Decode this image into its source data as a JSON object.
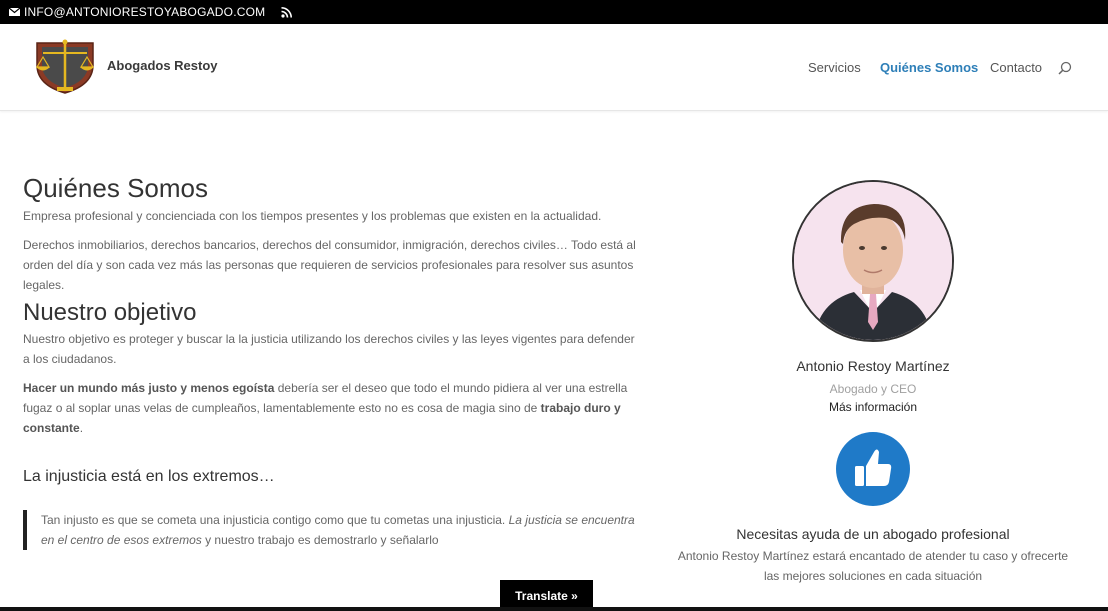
{
  "topbar": {
    "email": "INFO@ANTONIORESTOYABOGADO.COM",
    "mail_icon": "mail-icon",
    "rss_icon": "rss-icon"
  },
  "header": {
    "brand": "Abogados Restoy",
    "nav": [
      "Servicios",
      "Quiénes Somos",
      "Contacto"
    ],
    "active_nav": "Quiénes Somos",
    "accent_color": "#2e7fb8"
  },
  "main": {
    "title": "Quiénes Somos",
    "intro": "Empresa profesional y concienciada con los tiempos presentes y los problemas que existen en la actualidad.",
    "para1": "Derechos inmobiliarios, derechos bancarios, derechos del consumidor, inmigración, derechos civiles… Todo está al orden del día y son cada vez más las personas que requieren de servicios profesionales para resolver sus asuntos legales.",
    "title2": "Nuestro objetivo",
    "para2": "Nuestro objetivo es proteger y buscar la la justicia utilizando los derechos civiles y las leyes vigentes para defender a los ciudadanos.",
    "para3_bold1": "Hacer un mundo más justo y menos egoísta",
    "para3_mid": " debería ser el deseo que todo el mundo pidiera al ver una estrella fugaz o al soplar unas velas de cumpleaños, lamentablemente esto no es cosa de magia sino de ",
    "para3_bold2": "trabajo duro y constante",
    "para3_end": ".",
    "subtitle": "La injusticia está en los extremos…",
    "quote_a": "Tan injusto es que se cometa una injusticia contigo como que tu cometas una injusticia. ",
    "quote_em": "La justicia se encuentra en el centro de esos extremos",
    "quote_b": " y nuestro trabajo es demostrarlo y señalarlo"
  },
  "profile": {
    "name": "Antonio Restoy Martínez",
    "role": "Abogado y CEO",
    "more": "Más información",
    "icon": "thumbs-up-icon",
    "icon_bg": "#1f7ac8",
    "help_title": "Necesitas ayuda de un abogado profesional",
    "help_text": "Antonio Restoy Martínez estará encantado de atender tu caso y ofrecerte las mejores soluciones en cada situación"
  },
  "translate": {
    "label": "Translate »"
  }
}
